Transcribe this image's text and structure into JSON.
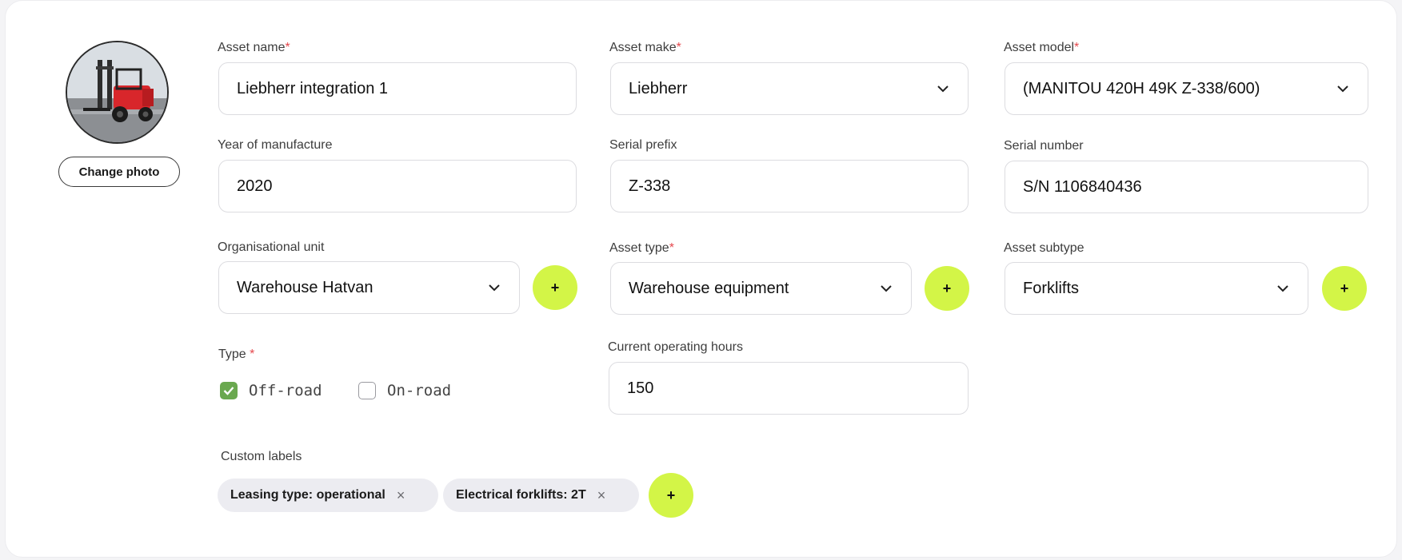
{
  "photo": {
    "change_label": "Change photo"
  },
  "fields": {
    "asset_name": {
      "label": "Asset name",
      "required": "*",
      "value": "Liebherr integration 1"
    },
    "asset_make": {
      "label": "Asset make",
      "required": "*",
      "value": "Liebherr"
    },
    "asset_model": {
      "label": "Asset model",
      "required": "*",
      "value": "(MANITOU 420H 49K Z-338/600)"
    },
    "year": {
      "label": "Year of manufacture",
      "value": "2020"
    },
    "serial_prefix": {
      "label": "Serial prefix",
      "value": "Z-338"
    },
    "serial_number": {
      "label": "Serial number",
      "value": "S/N 1106840436"
    },
    "org_unit": {
      "label": "Organisational unit",
      "value": "Warehouse Hatvan"
    },
    "asset_type": {
      "label": "Asset type",
      "required": "*",
      "value": "Warehouse equipment"
    },
    "asset_subtype": {
      "label": "Asset subtype",
      "value": "Forklifts"
    },
    "operating_hours": {
      "label": "Current operating hours",
      "value": "150"
    }
  },
  "type": {
    "label": "Type",
    "required": " *",
    "options": [
      {
        "label": "Off-road",
        "checked": true
      },
      {
        "label": "On-road",
        "checked": false
      }
    ]
  },
  "custom_labels": {
    "label": "Custom labels",
    "chips": [
      {
        "text": "Leasing type: operational"
      },
      {
        "text": "Electrical forklifts: 2T"
      }
    ],
    "remove_icon": "×"
  },
  "add_icon": "+",
  "colors": {
    "accent": "#d3f547",
    "checkbox_checked": "#6aa84f",
    "required": "#e5484d"
  },
  "icons": [
    "chevron-down-icon",
    "plus-icon",
    "close-icon",
    "check-icon"
  ]
}
